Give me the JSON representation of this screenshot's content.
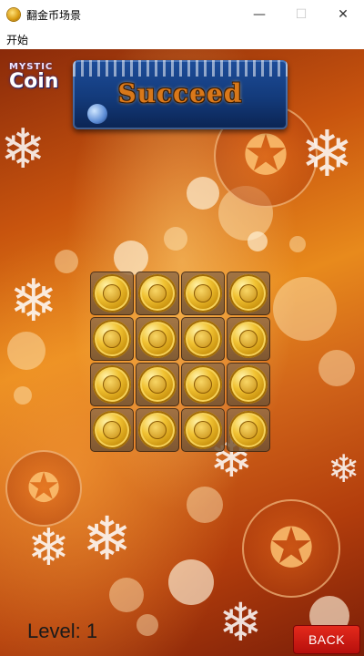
{
  "window": {
    "title": "翻金币场景",
    "app_icon": "coin-icon",
    "controls": {
      "minimize": "—",
      "maximize": "☐",
      "close": "✕"
    }
  },
  "menu": {
    "items": [
      "开始"
    ]
  },
  "game": {
    "logo": {
      "top": "MYSTIC",
      "main": "Coin"
    },
    "banner": {
      "text": "Succeed"
    },
    "grid": {
      "rows": 4,
      "cols": 4,
      "tile": "coin-gold-side"
    },
    "level_label": "Level: 1",
    "back_button": "BACK",
    "colors": {
      "back_button": "#d01e16",
      "banner": "#133a7a",
      "coin": "#f1c232"
    }
  }
}
